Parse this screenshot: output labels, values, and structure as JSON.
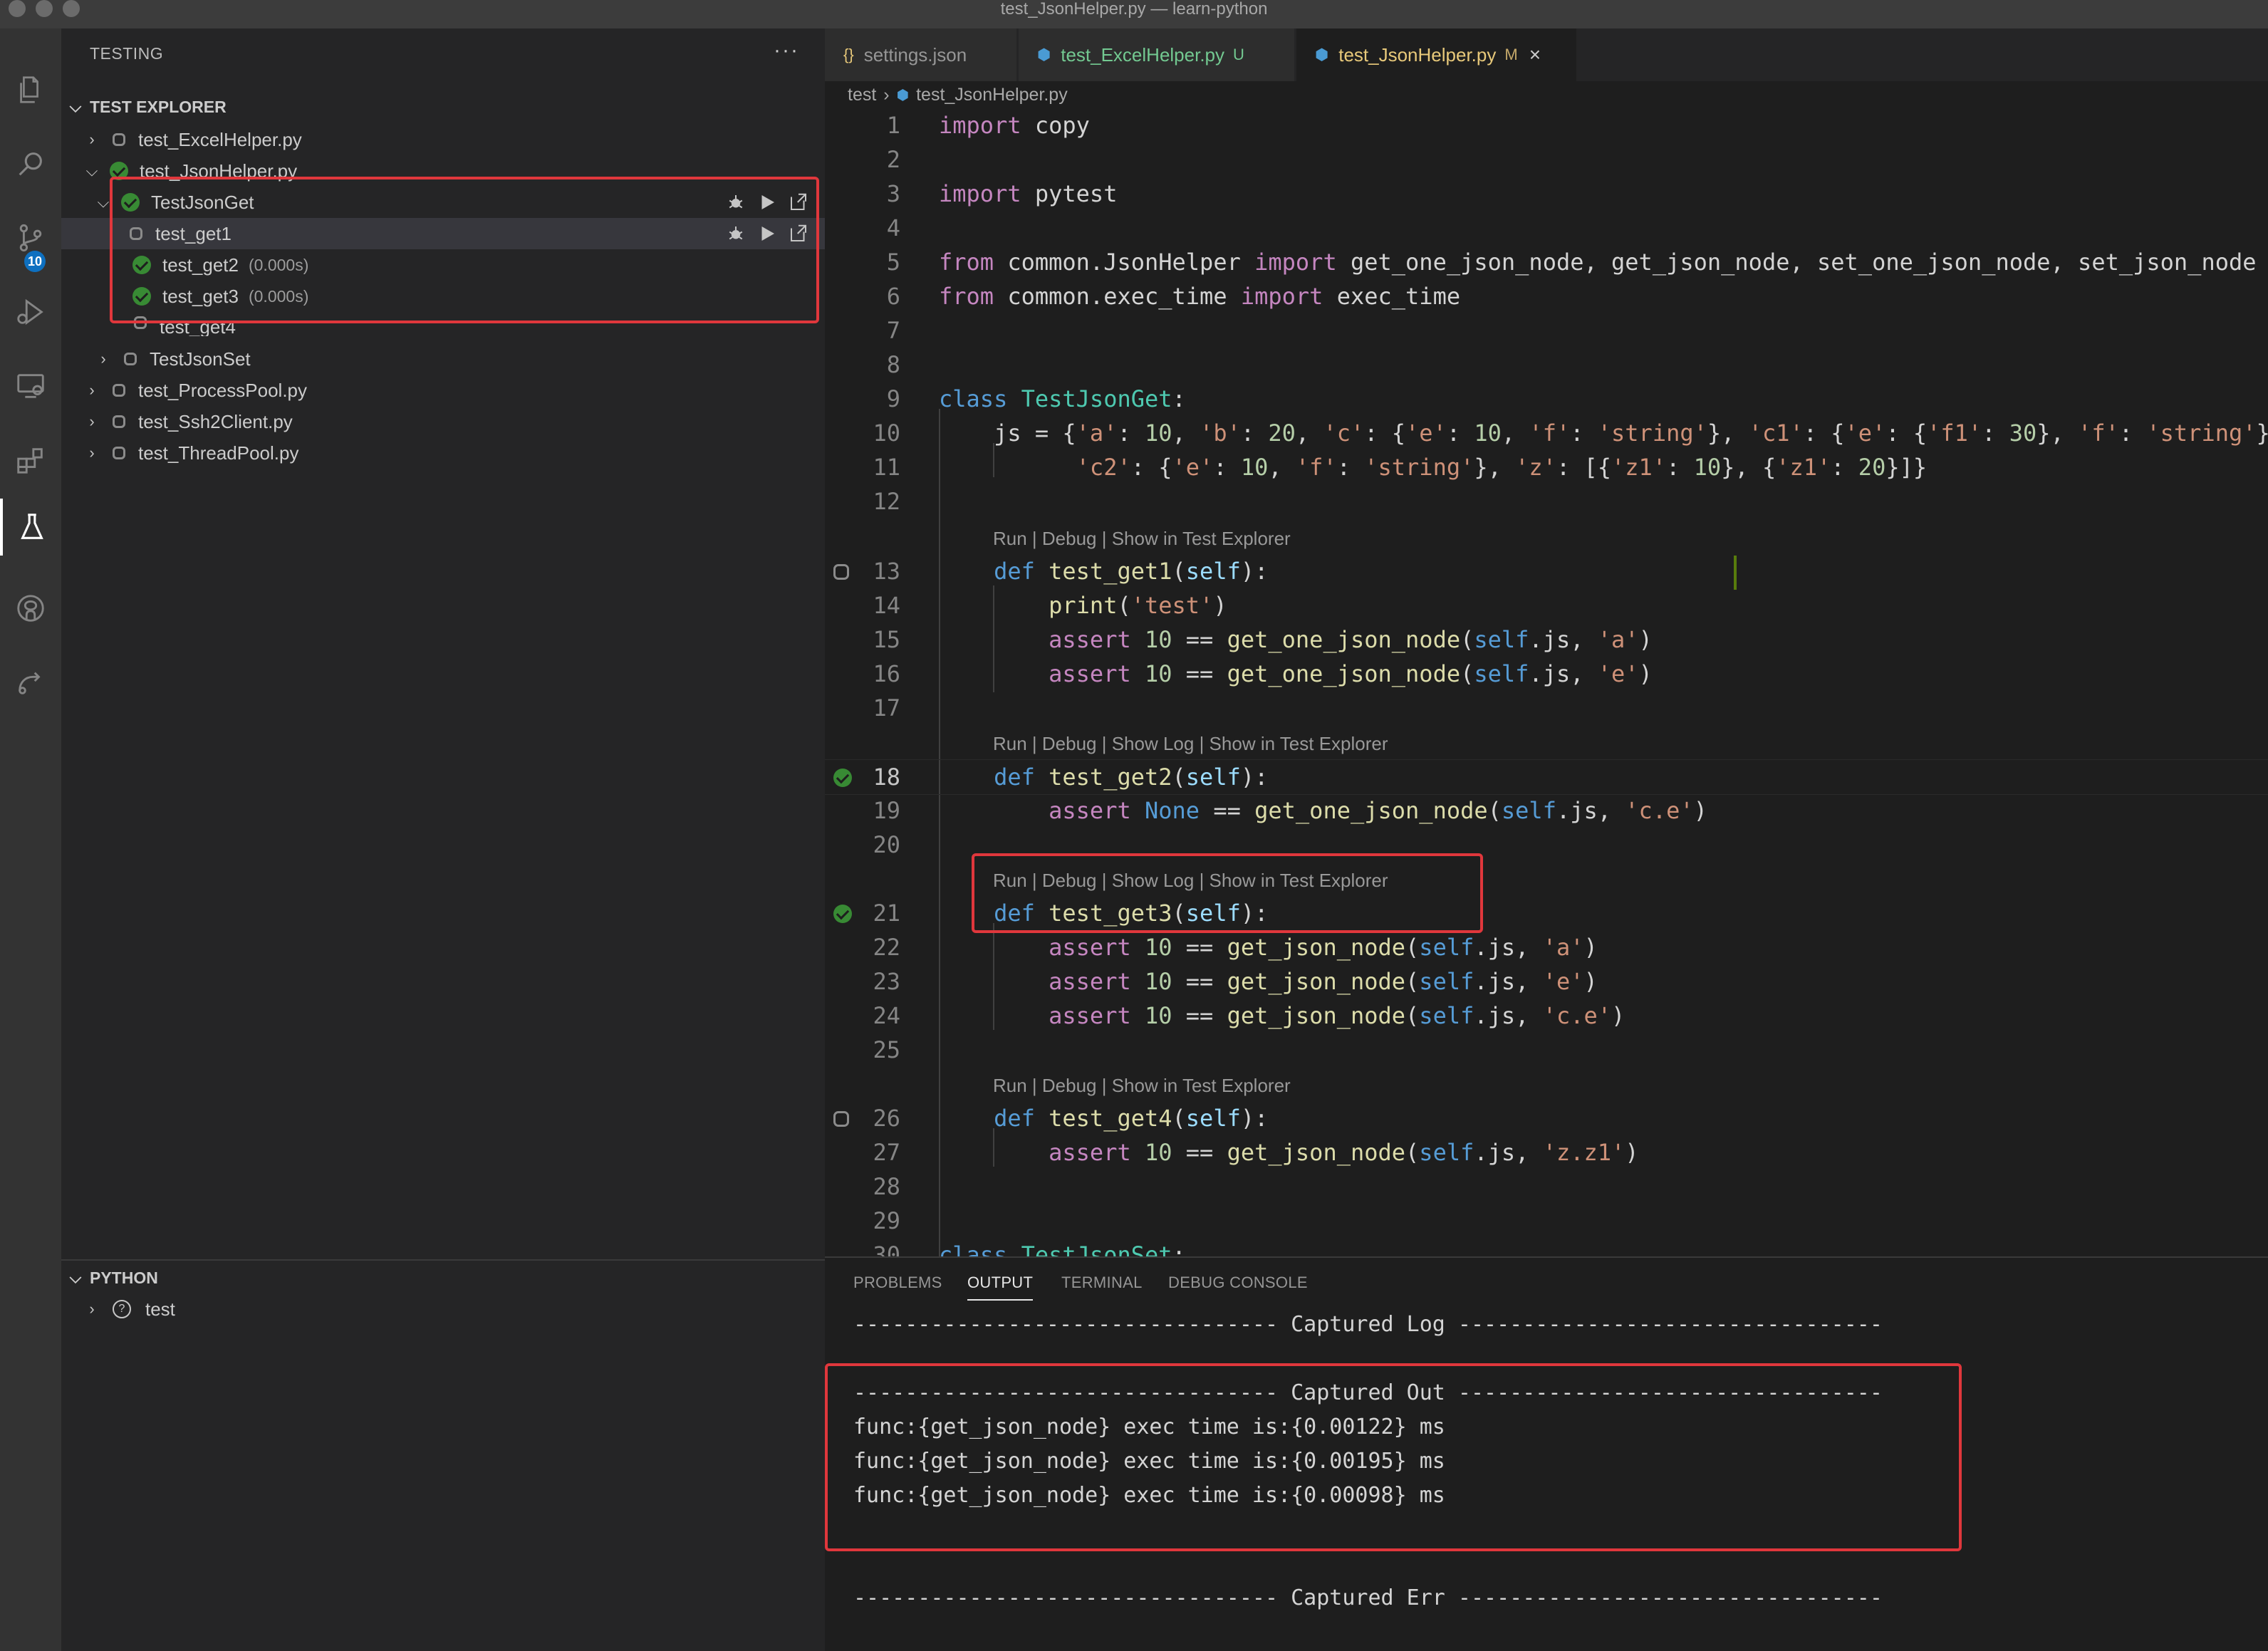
{
  "window": {
    "title": "test_JsonHelper.py — learn-python"
  },
  "activity_bar": {
    "items": [
      "explorer",
      "search",
      "source-control",
      "run-and-debug",
      "remote-explorer",
      "extensions",
      "testing",
      "github",
      "remote"
    ],
    "source_control_badge": "10"
  },
  "sidebar": {
    "title": "TESTING",
    "more": "···",
    "test_explorer": {
      "heading": "TEST EXPLORER",
      "items": [
        {
          "label": "test_ExcelHelper.py",
          "status": "none",
          "expanded": false
        },
        {
          "label": "test_JsonHelper.py",
          "status": "passed",
          "expanded": true
        },
        {
          "label": "TestJsonGet",
          "status": "passed",
          "expanded": true
        },
        {
          "label": "test_get1",
          "status": "none"
        },
        {
          "label": "test_get2",
          "status": "passed",
          "duration": "(0.000s)"
        },
        {
          "label": "test_get3",
          "status": "passed",
          "duration": "(0.000s)"
        },
        {
          "label": "test_get4",
          "status": "none"
        },
        {
          "label": "TestJsonSet",
          "status": "none",
          "expanded": false
        },
        {
          "label": "test_ProcessPool.py",
          "status": "none",
          "expanded": false
        },
        {
          "label": "test_Ssh2Client.py",
          "status": "none",
          "expanded": false
        },
        {
          "label": "test_ThreadPool.py",
          "status": "none",
          "expanded": false
        }
      ]
    },
    "python": {
      "heading": "PYTHON",
      "items": [
        {
          "label": "test",
          "icon": "question-circle-icon"
        }
      ]
    }
  },
  "tabs": [
    {
      "label": "settings.json",
      "icon": "{}",
      "decoration": ""
    },
    {
      "label": "test_ExcelHelper.py",
      "icon": "python",
      "decoration": "U"
    },
    {
      "label": "test_JsonHelper.py",
      "icon": "python",
      "decoration": "M",
      "active": true
    }
  ],
  "breadcrumb": {
    "folder": "test",
    "file": "test_JsonHelper.py"
  },
  "code_lens": {
    "basic": "Run | Debug | Show in Test Explorer",
    "with_log": "Run | Debug | Show Log | Show in Test Explorer"
  },
  "code_lines": [
    "import copy",
    "",
    "import pytest",
    "",
    "from common.JsonHelper import get_one_json_node, get_json_node, set_one_json_node, set_json_node",
    "from common.exec_time import exec_time",
    "",
    "",
    "class TestJsonGet:",
    "    js = {'a': 10, 'b': 20, 'c': {'e': 10, 'f': 'string'}, 'c1': {'e': {'f1': 30}, 'f': 'string'},",
    "          'c2': {'e': 10, 'f': 'string'}, 'z': [{'z1': 10}, {'z1': 20}]}",
    "",
    "    def test_get1(self):",
    "        print('test')",
    "        assert 10 == get_one_json_node(self.js, 'a')",
    "        assert 10 == get_one_json_node(self.js, 'e')",
    "",
    "    def test_get2(self):",
    "        assert None == get_one_json_node(self.js, 'c.e')",
    "",
    "    def test_get3(self):",
    "        assert 10 == get_json_node(self.js, 'a')",
    "        assert 10 == get_json_node(self.js, 'e')",
    "        assert 10 == get_json_node(self.js, 'c.e')",
    "",
    "    def test_get4(self):",
    "        assert 10 == get_json_node(self.js, 'z.z1')",
    "",
    "",
    "class TestJsonSet:"
  ],
  "panel": {
    "tabs": [
      "PROBLEMS",
      "OUTPUT",
      "TERMINAL",
      "DEBUG CONSOLE"
    ],
    "active_tab": "OUTPUT",
    "output_lines": [
      "--------------------------------- Captured Log ---------------------------------",
      "",
      "--------------------------------- Captured Out ---------------------------------",
      "func:{get_json_node} exec time is:{0.00122} ms",
      "func:{get_json_node} exec time is:{0.00195} ms",
      "func:{get_json_node} exec time is:{0.00098} ms",
      "",
      "",
      "--------------------------------- Captured Err ---------------------------------"
    ]
  },
  "colors": {
    "highlight_box": "#e0373c",
    "passed": "#388a34",
    "accent_badge": "#0e70c0",
    "active_tab_text": "#e8c97a"
  }
}
